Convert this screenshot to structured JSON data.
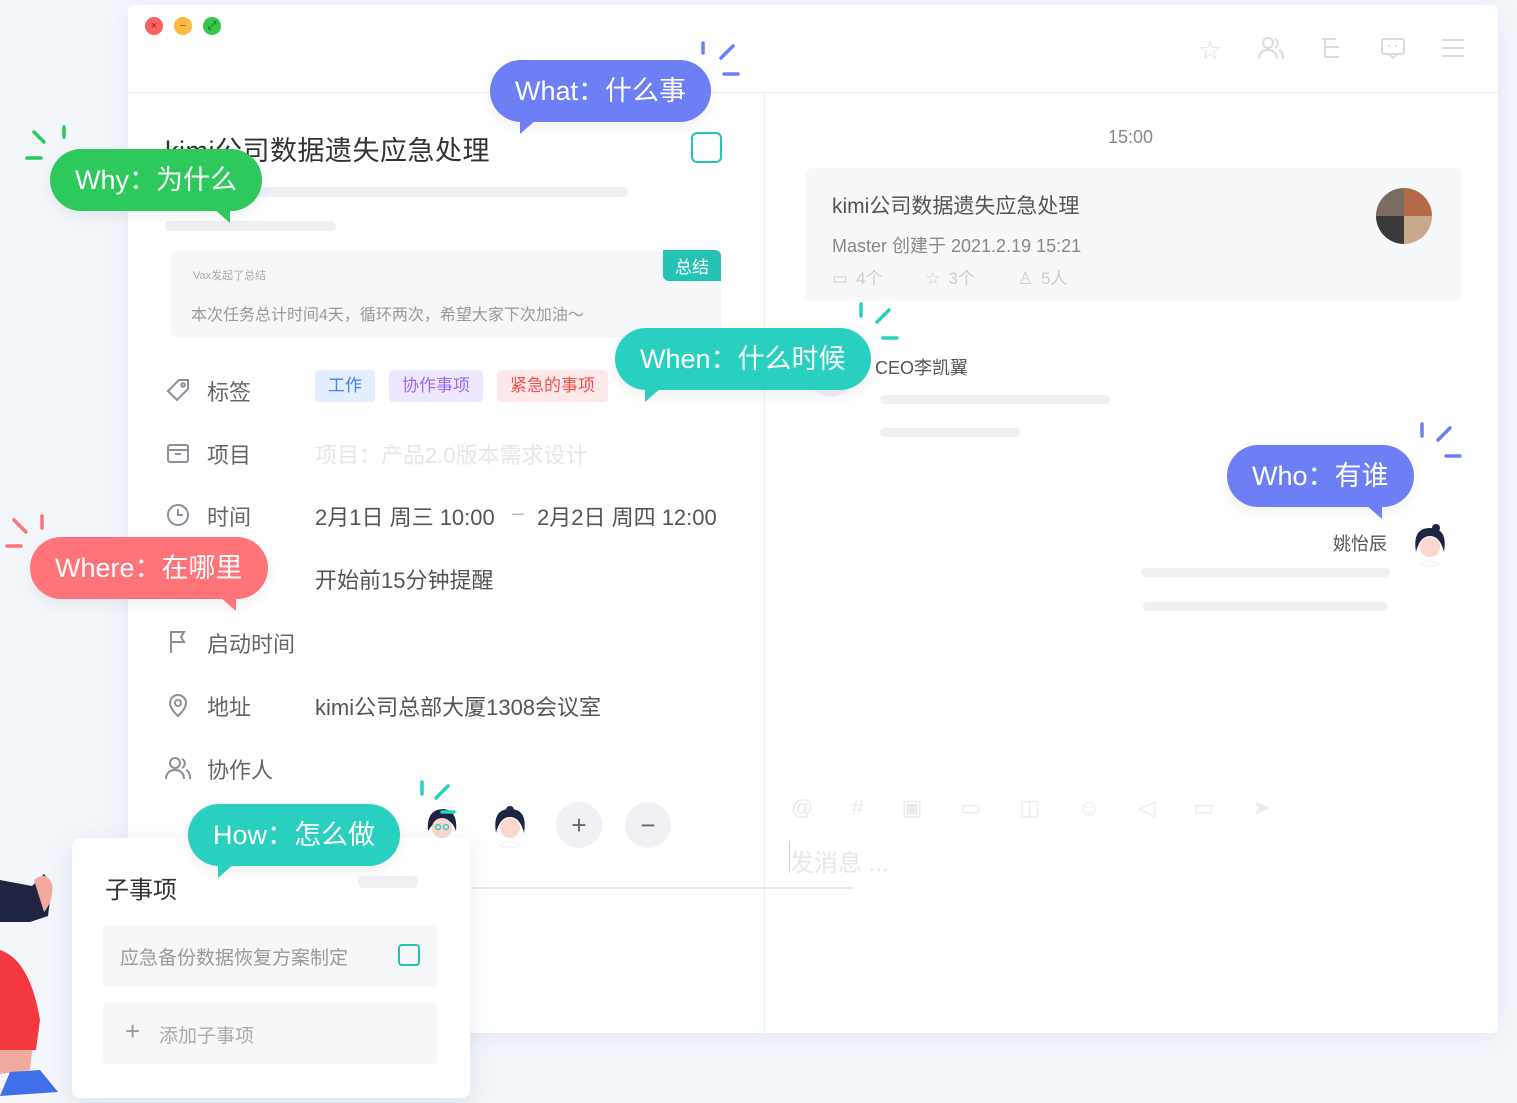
{
  "window": {
    "controls": {
      "close": "×",
      "minimize": "−",
      "maximize": "⤢"
    },
    "toolbar_icons": [
      "star-icon",
      "people-icon",
      "tree-icon",
      "chat-icon",
      "menu-icon"
    ]
  },
  "task": {
    "title": "kimi公司数据遗失应急处理",
    "summary": {
      "badge": "总结",
      "by": "Vax发起了总结",
      "text": "本次任务总计时间4天，循环两次，希望大家下次加油～"
    },
    "fields": {
      "tags_label": "标签",
      "tags": [
        "工作",
        "协作事项",
        "紧急的事项"
      ],
      "project_label": "项目",
      "project_value": "项目：产品2.0版本需求设计",
      "time_label": "时间",
      "time_start": "2月1日 周三 10:00",
      "time_sep": "–",
      "time_end": "2月2日  周四 12:00",
      "reminder": "开始前15分钟提醒",
      "start_label": "启动时间",
      "address_label": "地址",
      "address_value": "kimi公司总部大厦1308会议室",
      "collab_label": "协作人"
    },
    "buttons": {
      "add": "+",
      "remove": "−"
    }
  },
  "subtasks": {
    "title": "子事项",
    "items": [
      {
        "label": "应急备份数据恢复方案制定"
      }
    ],
    "add_label": "添加子事项",
    "add_icon": "+"
  },
  "chat": {
    "time": "15:00",
    "card": {
      "title": "kimi公司数据遗失应急处理",
      "subtitle": "Master 创建于 2021.2.19 15:21",
      "stat_folders": "4个",
      "stat_stars": "3个",
      "stat_people": "5人"
    },
    "messages": [
      {
        "name": "CEO李凯翼"
      },
      {
        "name": "姚怡辰"
      }
    ],
    "input_placeholder": "发消息 ..."
  },
  "bubbles": {
    "what": "What：什么事",
    "why": "Why：为什么",
    "when": "When：什么时候",
    "who": "Who：有谁",
    "where": "Where：在哪里",
    "how": "How：怎么做"
  },
  "colors": {
    "teal": "#29d0bf",
    "indigo": "#6e7ff5",
    "green": "#2ec95c",
    "coral": "#ff7478"
  }
}
